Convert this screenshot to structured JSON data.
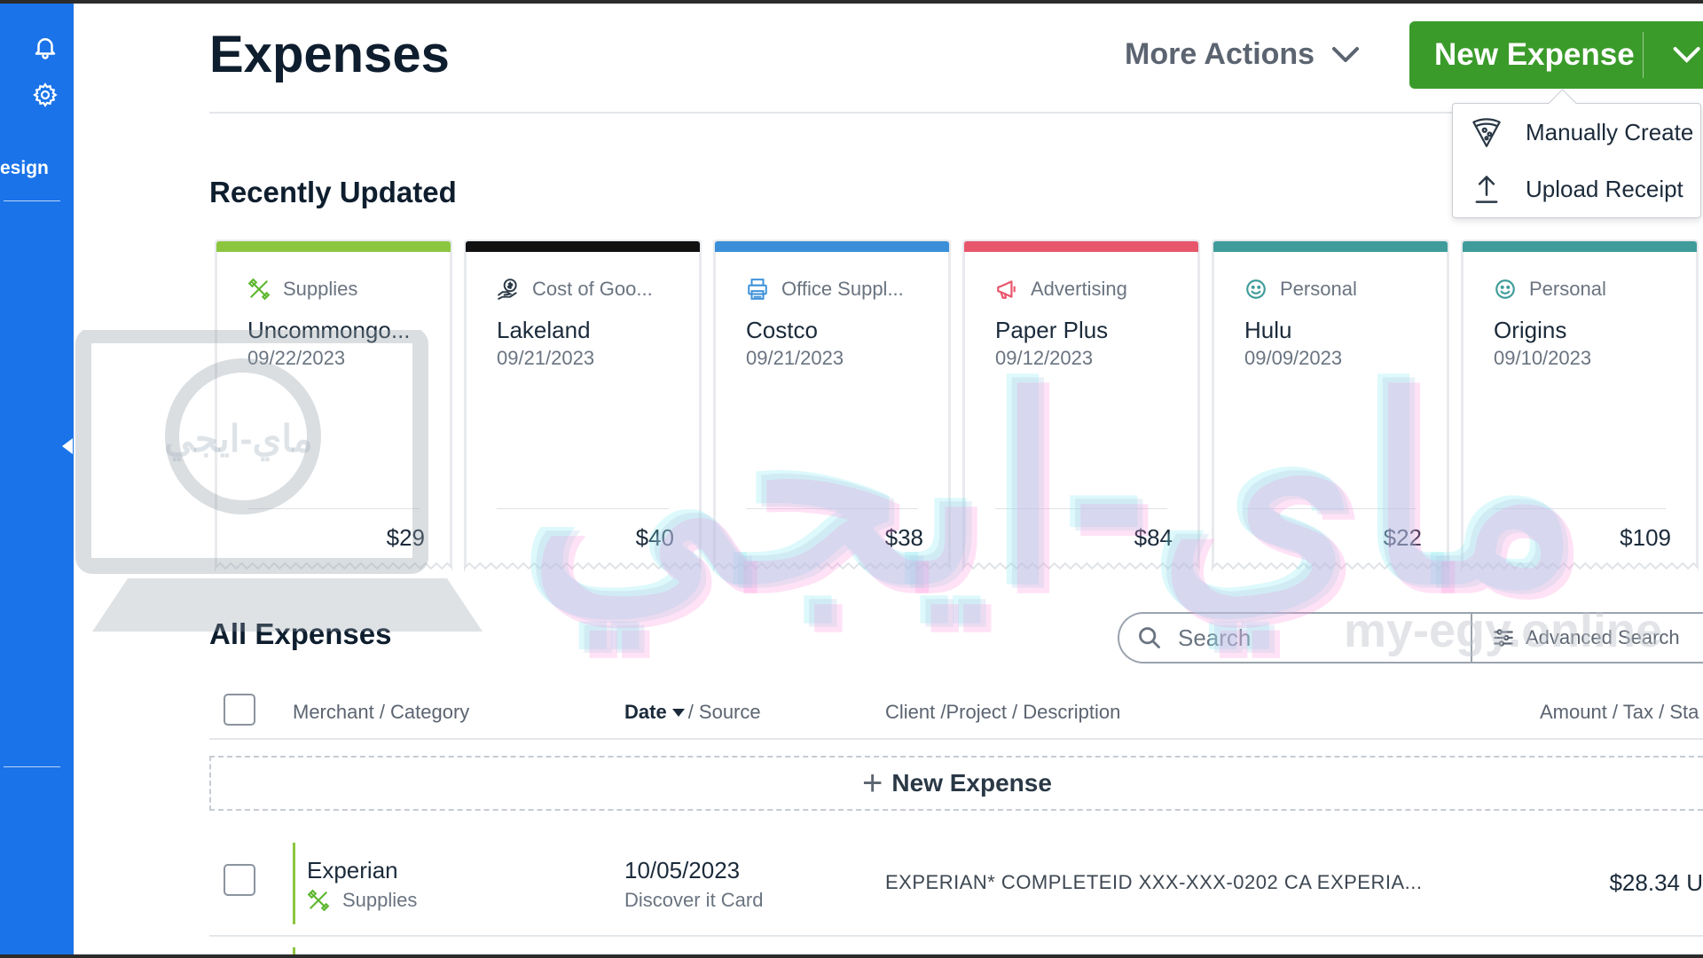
{
  "sidebar": {
    "partial_label": "esign"
  },
  "header": {
    "title": "Expenses",
    "more_actions_label": "More Actions",
    "new_expense_label": "New Expense"
  },
  "dropdown": {
    "items": [
      {
        "label": "Manually Create",
        "icon": "pizza-slice-icon"
      },
      {
        "label": "Upload Receipt",
        "icon": "upload-icon"
      }
    ]
  },
  "recently_updated": {
    "title": "Recently Updated",
    "cards": [
      {
        "category": "Supplies",
        "merchant": "Uncommongo...",
        "date": "09/22/2023",
        "amount": "$29",
        "bar_color": "#8cc63f",
        "icon": "tools-icon",
        "icon_color": "#5fb832"
      },
      {
        "category": "Cost of Goo...",
        "merchant": "Lakeland",
        "date": "09/21/2023",
        "amount": "$40",
        "bar_color": "#111111",
        "icon": "money-hand-icon",
        "icon_color": "#2a3846"
      },
      {
        "category": "Office Suppl...",
        "merchant": "Costco",
        "date": "09/21/2023",
        "amount": "$38",
        "bar_color": "#3a8fd8",
        "icon": "printer-icon",
        "icon_color": "#3a8fd8"
      },
      {
        "category": "Advertising",
        "merchant": "Paper Plus",
        "date": "09/12/2023",
        "amount": "$84",
        "bar_color": "#e8566c",
        "icon": "megaphone-icon",
        "icon_color": "#e8566c"
      },
      {
        "category": "Personal",
        "merchant": "Hulu",
        "date": "09/09/2023",
        "amount": "$22",
        "bar_color": "#3f9c9a",
        "icon": "smiley-icon",
        "icon_color": "#3f9c9a"
      },
      {
        "category": "Personal",
        "merchant": "Origins",
        "date": "09/10/2023",
        "amount": "$109",
        "bar_color": "#3f9c9a",
        "icon": "smiley-icon",
        "icon_color": "#3f9c9a"
      }
    ]
  },
  "all_expenses": {
    "title": "All Expenses",
    "search_placeholder": "Search",
    "advanced_search_label": "Advanced Search",
    "columns": {
      "merchant": "Merchant / Category",
      "date_bold": "Date",
      "date_rest": "/ Source",
      "client": "Client /Project / Description",
      "amount": "Amount / Tax / Sta"
    },
    "new_row_label": "New Expense",
    "rows": [
      {
        "merchant": "Experian",
        "category": "Supplies",
        "date": "10/05/2023",
        "source": "Discover it Card",
        "description": "EXPERIAN* COMPLETEID XXX-XXX-0202 CA EXPERIA...",
        "amount": "$28.34 U"
      }
    ]
  },
  "watermark": {
    "arabic": "ماي-ايجي",
    "latin": "my-egy.online"
  },
  "colors": {
    "sidebar": "#1a73e8",
    "primary_button": "#3a9b2a"
  }
}
